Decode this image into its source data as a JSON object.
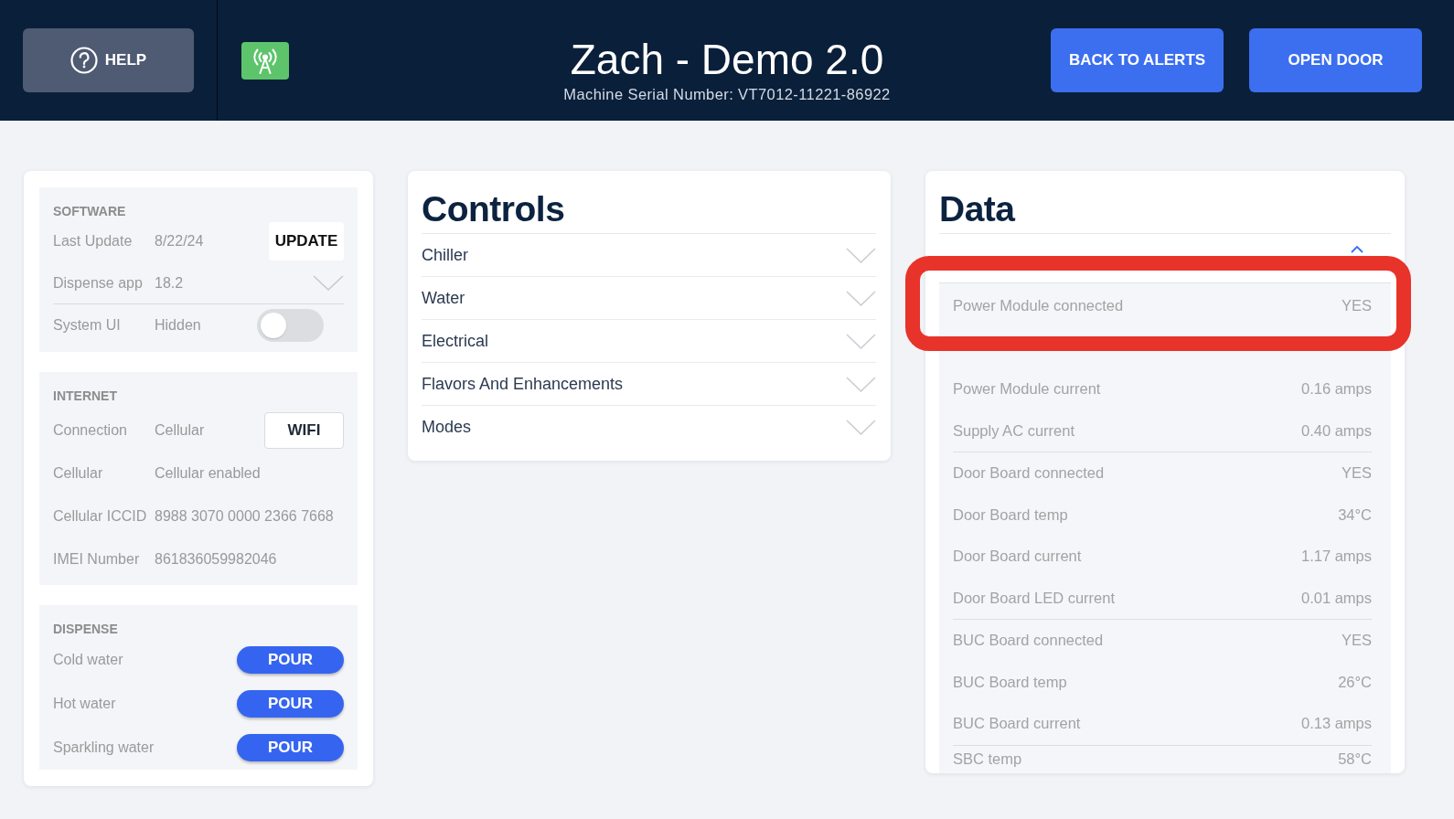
{
  "header": {
    "help_button": {
      "label": "HELP"
    },
    "title": "Zach - Demo 2.0",
    "subtitle": "Machine Serial Number: VT7012-11221-86922",
    "buttons": [
      {
        "label": "BACK TO ALERTS"
      },
      {
        "label": "OPEN DOOR"
      }
    ]
  },
  "status_panel": {
    "sections": [
      {
        "heading": "SOFTWARE",
        "rows": [
          {
            "kind": "button",
            "label": "Last Update",
            "value": "8/22/24",
            "action": "UPDATE"
          },
          {
            "kind": "dropdown",
            "label": "Dispense app",
            "value": "18.2",
            "expanded": false
          },
          {
            "kind": "toggle",
            "label": "System UI",
            "value": "Hidden",
            "on": false
          }
        ]
      },
      {
        "heading": "INTERNET",
        "rows": [
          {
            "kind": "outlined_button",
            "label": "Connection",
            "value": "Cellular",
            "action": "WIFI"
          },
          {
            "kind": "text",
            "label": "Cellular",
            "value": "Cellular enabled"
          },
          {
            "kind": "text",
            "label": "Cellular ICCID",
            "value": "8988 3070 0000 2366 7668"
          },
          {
            "kind": "text",
            "label": "IMEI Number",
            "value": "861836059982046"
          }
        ]
      },
      {
        "heading": "DISPENSE",
        "rows": [
          {
            "kind": "pour",
            "label": "Cold water",
            "action": "POUR"
          },
          {
            "kind": "pour",
            "label": "Hot water",
            "action": "POUR"
          },
          {
            "kind": "pour",
            "label": "Sparkling water",
            "action": "POUR"
          }
        ]
      }
    ]
  },
  "controls": {
    "title": "Controls",
    "items": [
      {
        "label": "Chiller",
        "expanded": false
      },
      {
        "label": "Water",
        "expanded": false
      },
      {
        "label": "Electrical",
        "expanded": false
      },
      {
        "label": "Flavors And Enhancements",
        "expanded": false
      },
      {
        "label": "Modes",
        "expanded": false
      }
    ]
  },
  "data": {
    "title": "Data",
    "sections": [
      {
        "expanded": true,
        "groups": [
          {
            "rows": [
              {
                "label": "Power Module connected",
                "value": "YES"
              },
              {
                "label": "Power Module current",
                "value": "0.16 amps"
              },
              {
                "label": "Supply AC current",
                "value": "0.40 amps"
              }
            ]
          },
          {
            "rows": [
              {
                "label": "Door Board connected",
                "value": "YES"
              },
              {
                "label": "Door Board temp",
                "value": "34°C"
              },
              {
                "label": "Door Board current",
                "value": "1.17 amps"
              },
              {
                "label": "Door Board LED current",
                "value": "0.01 amps"
              }
            ]
          },
          {
            "rows": [
              {
                "label": "BUC Board connected",
                "value": "YES"
              },
              {
                "label": "BUC Board temp",
                "value": "26°C"
              },
              {
                "label": "BUC Board current",
                "value": "0.13 amps"
              }
            ]
          },
          {
            "rows": [
              {
                "label": "SBC temp",
                "value": "58°C"
              }
            ]
          }
        ]
      }
    ],
    "annotation": {
      "kind": "highlight_frame"
    }
  }
}
